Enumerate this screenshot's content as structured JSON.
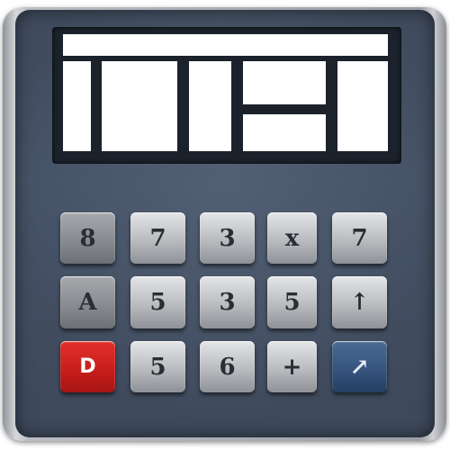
{
  "colors": {
    "face": "#3f4a5c",
    "key_silver": "#b9bbbf",
    "key_red": "#c41d1a",
    "key_blue": "#34527c",
    "display": "#ffffff"
  },
  "keypad": {
    "row1": [
      "8",
      "7",
      "3",
      "x",
      "7"
    ],
    "row2": [
      "A",
      "5",
      "3",
      "5",
      "↑"
    ],
    "row3": [
      "D",
      "5",
      "6",
      "+",
      "↗"
    ]
  }
}
